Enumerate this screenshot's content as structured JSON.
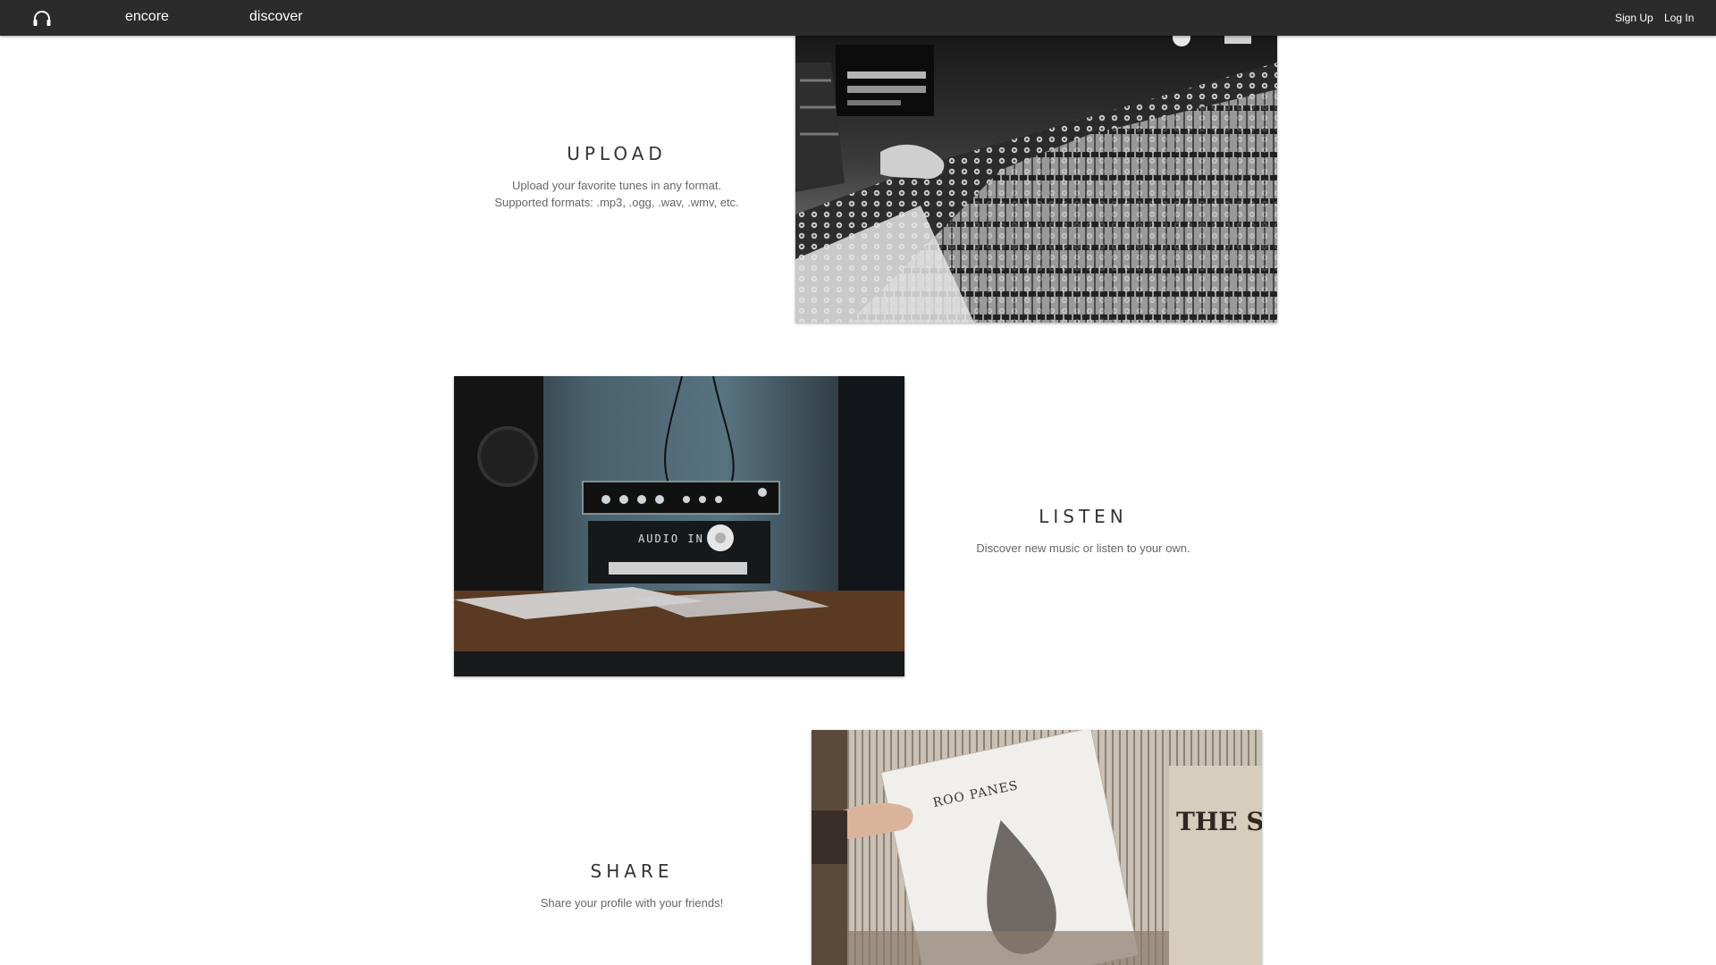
{
  "nav": {
    "logo_icon": "headphones-icon",
    "brand_label": "encore",
    "discover_label": "discover",
    "signup_label": "Sign Up",
    "login_label": "Log In"
  },
  "features": {
    "upload": {
      "title": "UPLOAD",
      "desc_line1": "Upload your favorite tunes in any format.",
      "desc_line2": "Supported formats: .mp3, .ogg, .wav, .wmv, etc."
    },
    "listen": {
      "title": "LISTEN",
      "desc": "Discover new music or listen to your own."
    },
    "share": {
      "title": "SHARE",
      "desc": "Share your profile with your friends!"
    }
  },
  "images": {
    "audio_display_text": "AUDIO IN",
    "record_sleeve_text": "ROO PANES",
    "crate_text": "THE S"
  },
  "colors": {
    "navbar": "#2b2b2b",
    "title": "#333333",
    "description": "#666666"
  }
}
